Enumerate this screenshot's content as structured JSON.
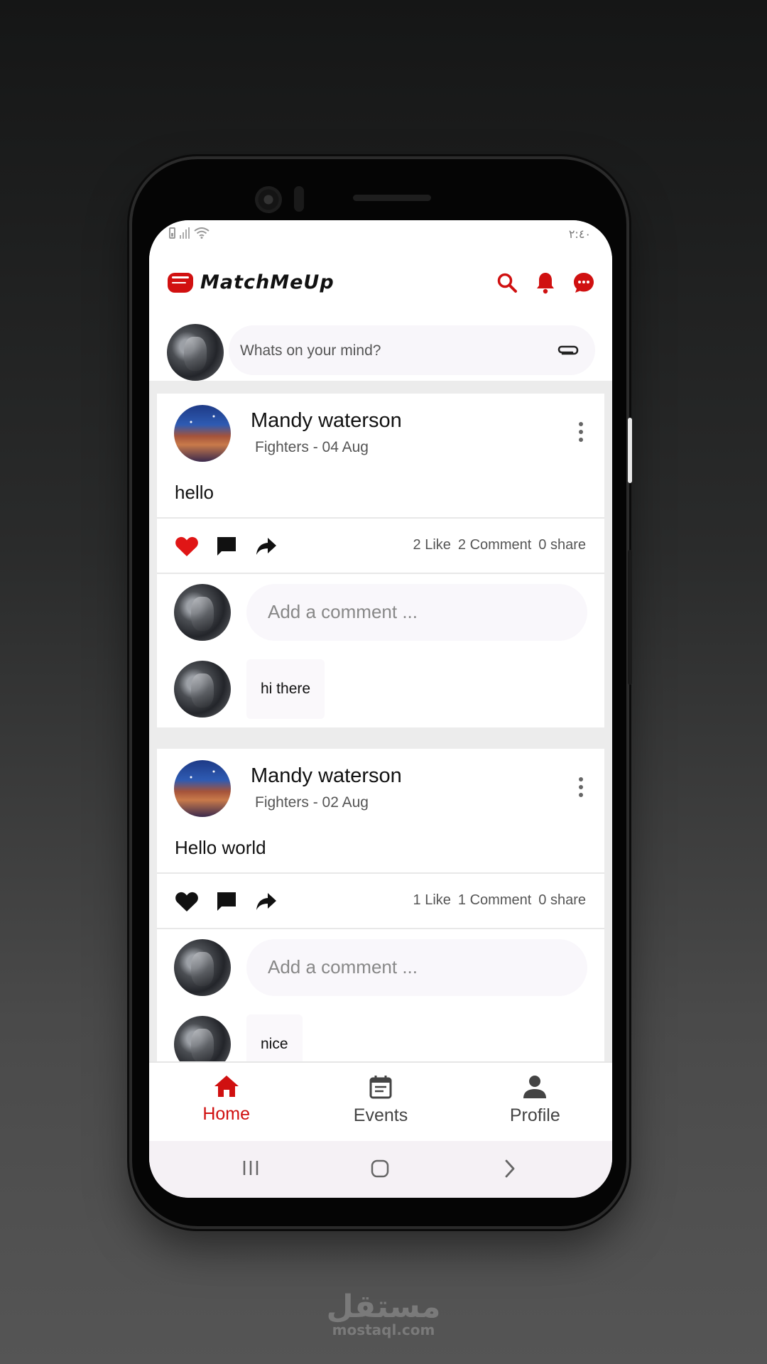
{
  "status": {
    "time": "٢:٤٠"
  },
  "appbar": {
    "logo_text": "MatchMeUp",
    "icons": [
      "search-icon",
      "bell-icon",
      "chat-icon"
    ],
    "accent": "#d01010"
  },
  "composer": {
    "placeholder": "Whats on your mind?"
  },
  "posts": [
    {
      "author": "Mandy waterson",
      "category": "Fighters",
      "separator": "-",
      "date": "04 Aug",
      "text": "hello",
      "liked": true,
      "likes": "2 Like",
      "comments": "2 Comment",
      "shares": "0 share",
      "comment_placeholder": "Add a comment ...",
      "reply": "hi there"
    },
    {
      "author": "Mandy waterson",
      "category": "Fighters",
      "separator": "-",
      "date": "02 Aug",
      "text": "Hello world",
      "liked": false,
      "likes": "1 Like",
      "comments": "1 Comment",
      "shares": "0 share",
      "comment_placeholder": "Add a comment ...",
      "reply": "nice"
    }
  ],
  "bottom_nav": [
    {
      "label": "Home",
      "icon": "home-icon",
      "active": true
    },
    {
      "label": "Events",
      "icon": "calendar-icon",
      "active": false
    },
    {
      "label": "Profile",
      "icon": "person-icon",
      "active": false
    }
  ],
  "watermark": {
    "arabic": "مستقل",
    "domain": "mostaql.com"
  }
}
